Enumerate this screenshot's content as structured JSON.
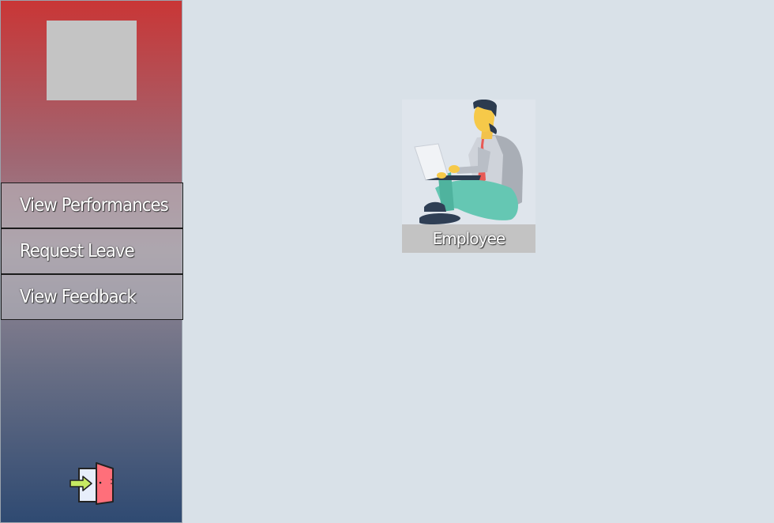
{
  "sidebar": {
    "logo_icon": "image-placeholder",
    "menu": [
      {
        "label": "View Performances"
      },
      {
        "label": "Request Leave"
      },
      {
        "label": "View Feedback"
      }
    ],
    "logout_icon": "logout-door-icon"
  },
  "main": {
    "profile": {
      "role_label": "Employee",
      "avatar_icon": "employee-avatar-illustration"
    }
  },
  "colors": {
    "sidebar_top": "#c93636",
    "sidebar_bottom": "#2f4a72",
    "background": "#d9e1e8"
  }
}
